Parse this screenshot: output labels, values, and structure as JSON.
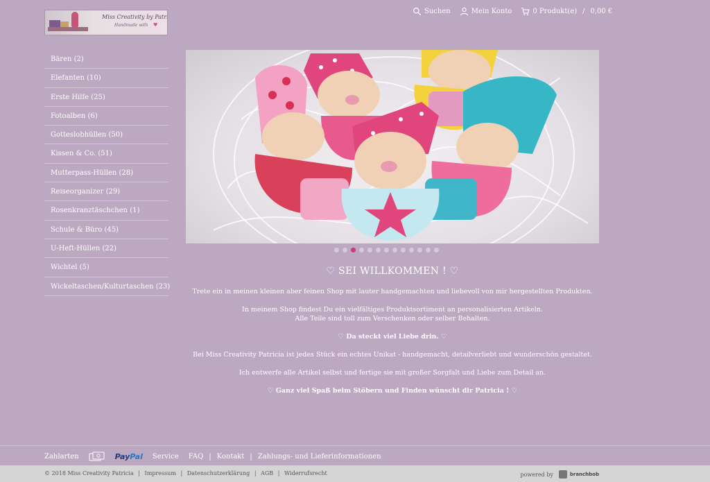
{
  "header": {
    "logo": {
      "brand": "Miss Creativity by Patricia",
      "sub": "Handmade with"
    },
    "nav": {
      "search": "Suchen",
      "account": "Mein Konto",
      "cart": "0 Produkt(e)",
      "cart_sep": "/",
      "cart_total": "0,00 €"
    }
  },
  "sidebar": {
    "categories": [
      {
        "label": "Bären (2)"
      },
      {
        "label": "Elefanten (10)"
      },
      {
        "label": "Erste Hilfe (25)"
      },
      {
        "label": "Fotoalben (6)"
      },
      {
        "label": "Gotteslobhüllen (50)"
      },
      {
        "label": "Kissen & Co. (51)"
      },
      {
        "label": "Mutterpass-Hüllen (28)"
      },
      {
        "label": "Reiseorganizer (29)"
      },
      {
        "label": "Rosenkranztäschchen (1)"
      },
      {
        "label": "Schule & Büro (45)"
      },
      {
        "label": "U-Heft-Hüllen (22)"
      },
      {
        "label": "Wichtel (5)"
      },
      {
        "label": "Wickeltaschen/Kulturtaschen (23)"
      }
    ]
  },
  "slider": {
    "dot_count": 13,
    "active_index": 2
  },
  "welcome": {
    "title": "♡ SEI WILLKOMMEN ! ♡",
    "p1": "Trete ein in meinen kleinen aber feinen Shop mit lauter handgemachten und liebevoll von mir hergestellten Produkten.",
    "p2a": "In meinem Shop findest Du ein vielfältiges Produktsortiment an personalisierten Artikeln.",
    "p2b": "Alle Teile sind toll zum Verschenken oder selber Behalten.",
    "p3": "♡ Da steckt viel Liebe drin. ♡",
    "p4": "Bei Miss Creativity Patricia ist jedes Stück ein echtes Unikat - handgemacht, detailverliebt und wunderschön gestaltet.",
    "p5": "Ich entwerfe alle Artikel selbst und fertige sie mit großer Sorgfalt und Liebe zum Detail an.",
    "p6": "♡ Ganz viel Spaß beim Stöbern und Finden wünscht dir Patricia ! ♡"
  },
  "footer": {
    "zahlarten": "Zahlarten",
    "paypal_pay": "Pay",
    "paypal_pal": "Pal",
    "service": "Service",
    "faq": "FAQ",
    "sep": "|",
    "kontakt": "Kontakt",
    "zahlungs": "Zahlungs- und Lieferinformationen",
    "copyright": "© 2018 Miss Creativity Patricia",
    "impressum": "Impressum",
    "datenschutz": "Datenschutzerklärung",
    "agb": "AGB",
    "widerruf": "Widerrufsrecht",
    "powered": "powered by",
    "branchbob": "branchbob"
  },
  "colors": {
    "background": "#bca8c1",
    "active_dot": "#d2357a",
    "footer_bar": "#d5d5d5"
  }
}
